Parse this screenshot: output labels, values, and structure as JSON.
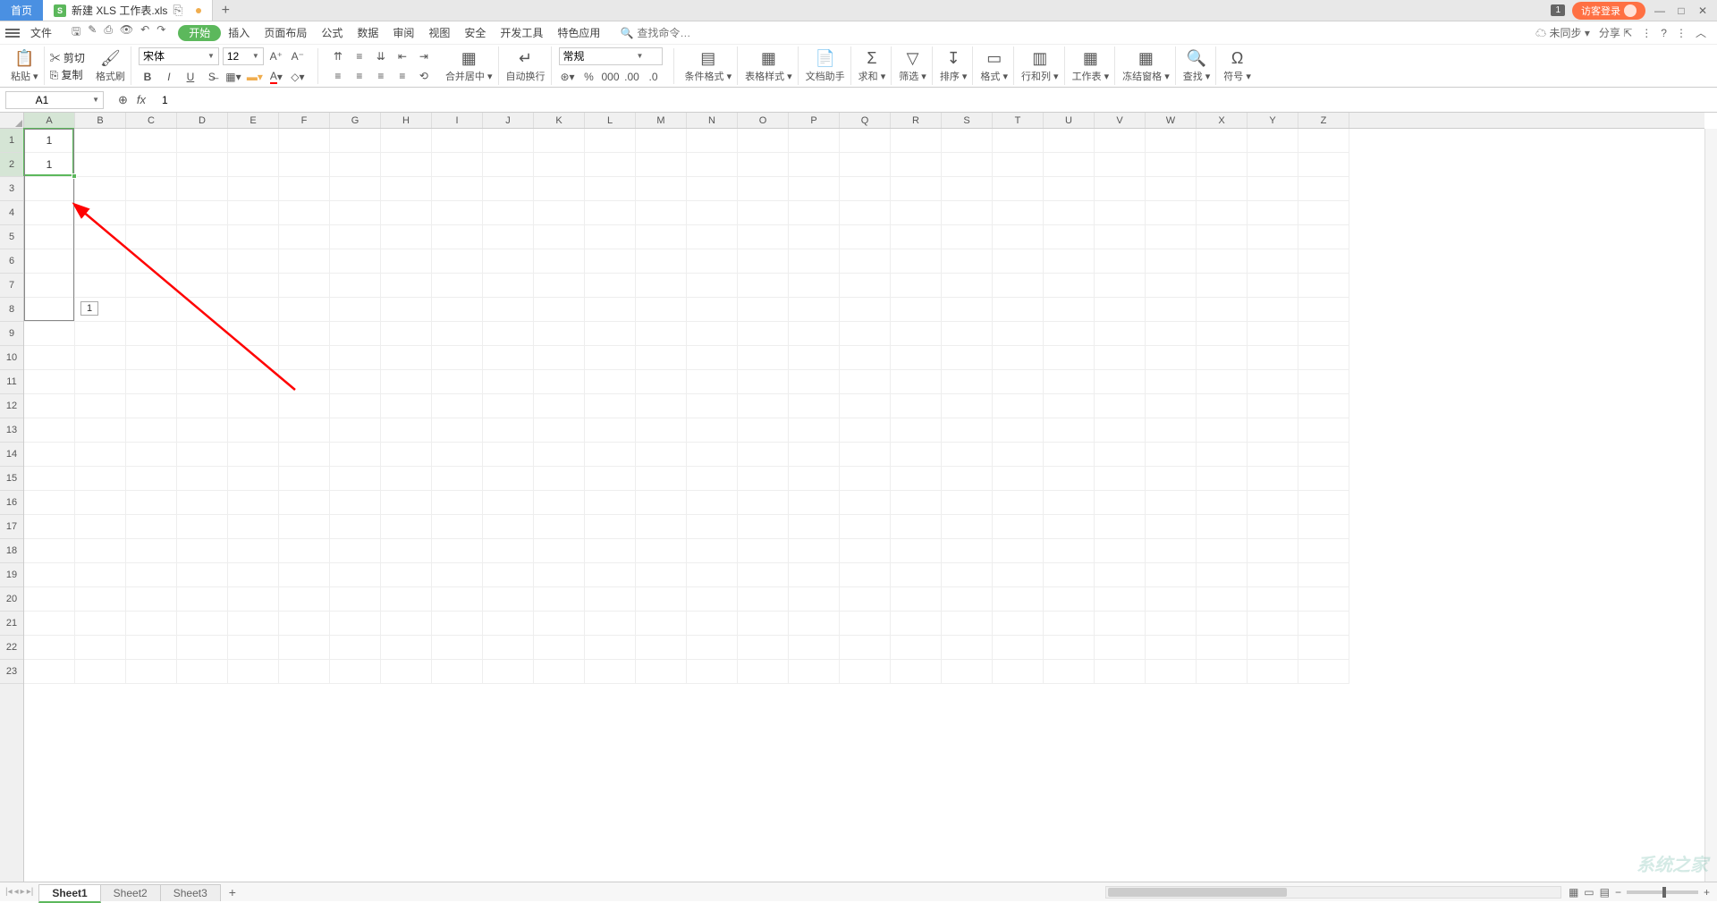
{
  "tabs": {
    "home": "首页",
    "file": "新建 XLS 工作表.xls"
  },
  "titlebar": {
    "badge": "1",
    "login": "访客登录"
  },
  "menu": {
    "file_label": "文件",
    "items": [
      "开始",
      "插入",
      "页面布局",
      "公式",
      "数据",
      "审阅",
      "视图",
      "安全",
      "开发工具",
      "特色应用"
    ],
    "search_placeholder": "查找命令…",
    "unsync": "未同步",
    "share": "分享"
  },
  "ribbon": {
    "paste": "粘贴",
    "cut": "剪切",
    "copy": "复制",
    "format_painter": "格式刷",
    "font": "宋体",
    "size": "12",
    "merge": "合并居中",
    "wrap": "自动换行",
    "numfmt": "常规",
    "cond": "条件格式",
    "tblstyle": "表格样式",
    "dochelper": "文档助手",
    "sum": "求和",
    "filter": "筛选",
    "sort": "排序",
    "fmt": "格式",
    "rowcol": "行和列",
    "sheet": "工作表",
    "freeze": "冻结窗格",
    "find": "查找",
    "symbol": "符号"
  },
  "namebox": "A1",
  "formula": "1",
  "cells": {
    "A1": "1",
    "A2": "1"
  },
  "tooltip": "1",
  "cols": [
    "A",
    "B",
    "C",
    "D",
    "E",
    "F",
    "G",
    "H",
    "I",
    "J",
    "K",
    "L",
    "M",
    "N",
    "O",
    "P",
    "Q",
    "R",
    "S",
    "T",
    "U",
    "V",
    "W",
    "X",
    "Y",
    "Z"
  ],
  "rows": 23,
  "selection": {
    "col": 0,
    "r1": 0,
    "r2": 1,
    "dragTo": 7
  },
  "sheets": [
    "Sheet1",
    "Sheet2",
    "Sheet3"
  ],
  "watermark": "系统之家"
}
